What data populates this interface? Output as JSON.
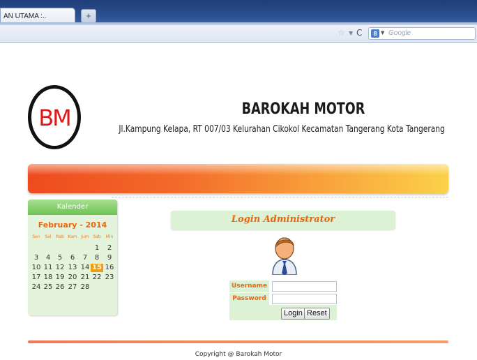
{
  "browser": {
    "tab_title": "AN UTAMA :..",
    "new_tab_label": "+",
    "search_engine_label": "8",
    "search_placeholder": "Google"
  },
  "site": {
    "logo_text": "BM",
    "title": "BAROKAH MOTOR",
    "address": "Jl.Kampung Kelapa, RT 007/03 Kelurahan Cikokol Kecamatan Tangerang Kota Tangerang"
  },
  "calendar": {
    "heading": "Kalender",
    "month_label": "February - 2014",
    "weekdays": [
      "Sen",
      "Sel",
      "Rab",
      "Kam",
      "Jum",
      "Sab",
      "Min"
    ],
    "weeks": [
      [
        "",
        "",
        "",
        "",
        "",
        "1",
        "2"
      ],
      [
        "3",
        "4",
        "5",
        "6",
        "7",
        "8",
        "9"
      ],
      [
        "10",
        "11",
        "12",
        "13",
        "14",
        "15",
        "16"
      ],
      [
        "17",
        "18",
        "19",
        "20",
        "21",
        "22",
        "23"
      ],
      [
        "24",
        "25",
        "26",
        "27",
        "28",
        "",
        ""
      ]
    ],
    "today": "15"
  },
  "login": {
    "title": "Login Administrator",
    "username_label": "Username",
    "password_label": "Password",
    "username_value": "",
    "password_value": "",
    "login_button": "Login",
    "reset_button": "Reset"
  },
  "footer": {
    "copyright": "Copyright @ Barokah Motor"
  }
}
